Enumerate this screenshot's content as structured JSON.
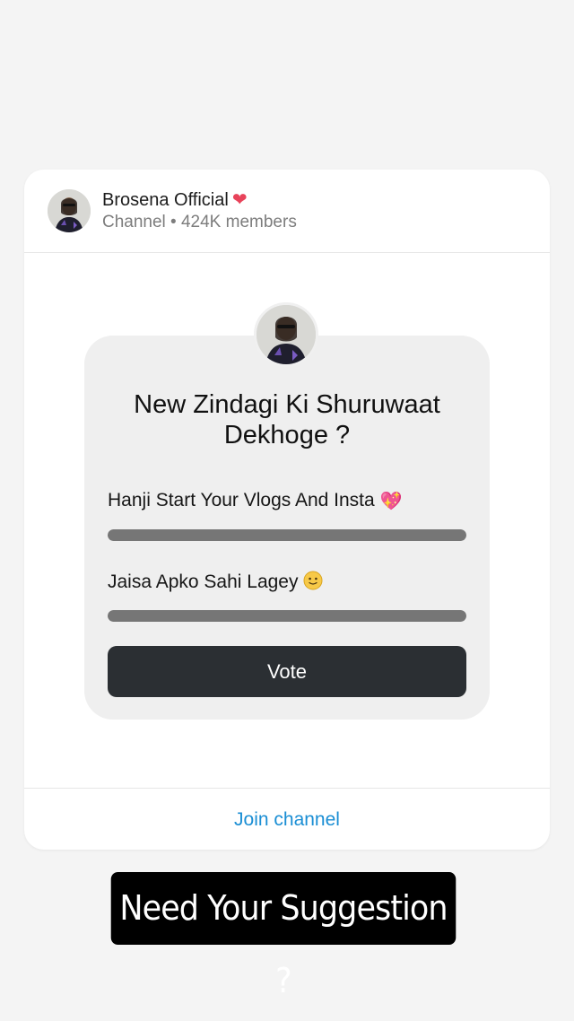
{
  "channel": {
    "name": "Brosena Official",
    "name_icon": "red-heart-icon",
    "meta": "Channel • 424K members"
  },
  "poll": {
    "question": "New Zindagi Ki Shuruwaat Dekhoge ?",
    "options": [
      {
        "label": "Hanji Start Your Vlogs And Insta",
        "icon": "sparkling-heart-icon",
        "fill_fraction": 1.0
      },
      {
        "label": "Jaisa Apko Sahi Lagey",
        "icon": "slightly-smiling-face-icon",
        "fill_fraction": 1.0
      }
    ],
    "vote_label": "Vote"
  },
  "footer": {
    "join_label": "Join channel"
  },
  "caption": "Need Your Suggestion ?",
  "colors": {
    "background": "#f4f4f4",
    "card": "#ffffff",
    "poll_box": "#efefef",
    "bar_fill": "#767676",
    "vote_button": "#2b2f33",
    "join_link": "#1a8ed4",
    "heart": "#e8435a"
  }
}
